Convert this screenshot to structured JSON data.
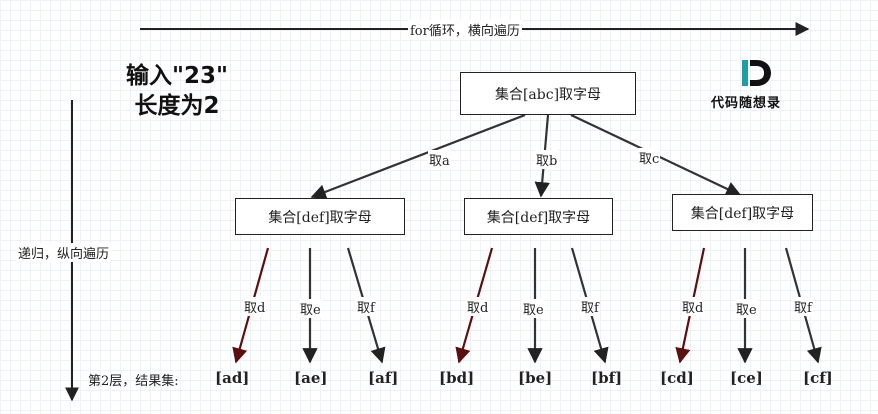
{
  "top_arrow_label": "for循环，横向遍历",
  "side_arrow_label": "递归，纵向遍历",
  "title": [
    "输入\"23\"",
    "长度为2"
  ],
  "logo": {
    "text": "代码随想录",
    "accent": "#1f9ca8"
  },
  "root": {
    "label": "集合[abc]取字母"
  },
  "level1": [
    {
      "edge": "取a",
      "label": "集合[def]取字母"
    },
    {
      "edge": "取b",
      "label": "集合[def]取字母"
    },
    {
      "edge": "取c",
      "label": "集合[def]取字母"
    }
  ],
  "leaf_edges": [
    "取d",
    "取e",
    "取f"
  ],
  "result_caption": "第2层，结果集:",
  "results": [
    "[ad]",
    "[ae]",
    "[af]",
    "[bd]",
    "[be]",
    "[bf]",
    "[cd]",
    "[ce]",
    "[cf]"
  ],
  "colors": {
    "highlight_edge": "#5a1010",
    "edge": "#333333"
  }
}
